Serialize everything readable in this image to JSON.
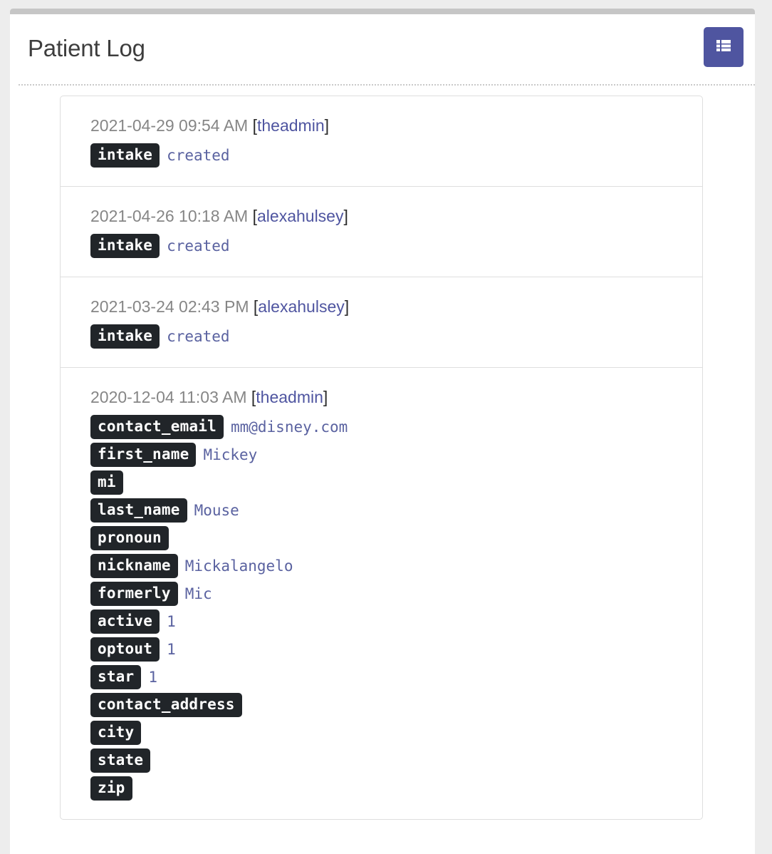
{
  "header": {
    "title": "Patient Log",
    "table_view_button_label": "",
    "table_view_icon": "table-grid-icon"
  },
  "colors": {
    "page_background": "#ededed",
    "panel_background": "#ffffff",
    "accent_indigo": "#4f55a0",
    "badge_background": "#212529",
    "badge_text": "#ffffff",
    "value_text": "#5a62a0",
    "timestamp_text": "#868686",
    "card_border": "#dedede",
    "scrollbar": "#c6c6c6"
  },
  "log": {
    "entries": [
      {
        "timestamp": "2021-04-29 09:54 AM",
        "user": "theadmin",
        "fields": [
          {
            "name": "intake",
            "value": "created"
          }
        ]
      },
      {
        "timestamp": "2021-04-26 10:18 AM",
        "user": "alexahulsey",
        "fields": [
          {
            "name": "intake",
            "value": "created"
          }
        ]
      },
      {
        "timestamp": "2021-03-24 02:43 PM",
        "user": "alexahulsey",
        "fields": [
          {
            "name": "intake",
            "value": "created"
          }
        ]
      },
      {
        "timestamp": "2020-12-04 11:03 AM",
        "user": "theadmin",
        "fields": [
          {
            "name": "contact_email",
            "value": "mm@disney.com"
          },
          {
            "name": "first_name",
            "value": "Mickey"
          },
          {
            "name": "mi",
            "value": ""
          },
          {
            "name": "last_name",
            "value": "Mouse"
          },
          {
            "name": "pronoun",
            "value": ""
          },
          {
            "name": "nickname",
            "value": "Mickalangelo"
          },
          {
            "name": "formerly",
            "value": "Mic"
          },
          {
            "name": "active",
            "value": "1"
          },
          {
            "name": "optout",
            "value": "1"
          },
          {
            "name": "star",
            "value": "1"
          },
          {
            "name": "contact_address",
            "value": ""
          },
          {
            "name": "city",
            "value": ""
          },
          {
            "name": "state",
            "value": ""
          },
          {
            "name": "zip",
            "value": ""
          }
        ]
      }
    ]
  }
}
